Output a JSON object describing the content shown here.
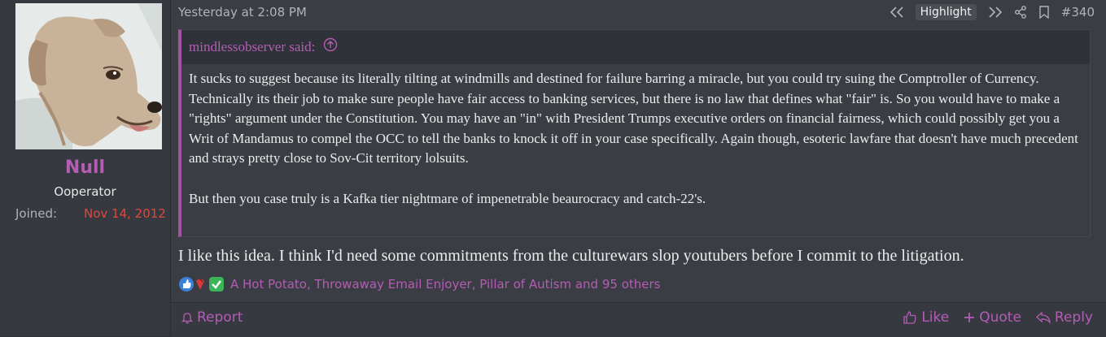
{
  "user": {
    "name": "Null",
    "title": "Ooperator",
    "joined_label": "Joined:",
    "joined_date": "Nov 14, 2012"
  },
  "post": {
    "date": "Yesterday at 2:08 PM",
    "highlight_label": "Highlight",
    "number": "#340",
    "quote_author": "mindlessobserver said:",
    "quote_paragraphs": [
      "It sucks to suggest because its literally tilting at windmills and destined for failure barring a miracle, but you could try suing the Comptroller of Currency. Technically its their job to make sure people have fair access to banking services, but there is no law that defines what \"fair\" is. So you would have to make a \"rights\" argument under the Constitution. You may have an \"in\" with President Trumps executive orders on financial fairness, which could possibly get you a Writ of Mandamus to compel the OCC to tell the banks to knock it off in your case specifically. Again though, esoteric lawfare that doesn't have much precedent and strays pretty close to Sov-Cit territory lolsuits.",
      "But then you case truly is a Kafka tier nightmare of impenetrable beaurocracy and catch-22's."
    ],
    "body": "I like this idea. I think I'd need some commitments from the culturewars slop youtubers before I commit to the litigation.",
    "reactions_text": "A Hot Potato, Throwaway Email Enjoyer, Pillar of Autism and 95 others"
  },
  "footer": {
    "report": "Report",
    "like": "Like",
    "quote": "Quote",
    "reply": "Reply"
  },
  "colors": {
    "accent": "#b55cb5",
    "joined_date": "#e0473c"
  }
}
